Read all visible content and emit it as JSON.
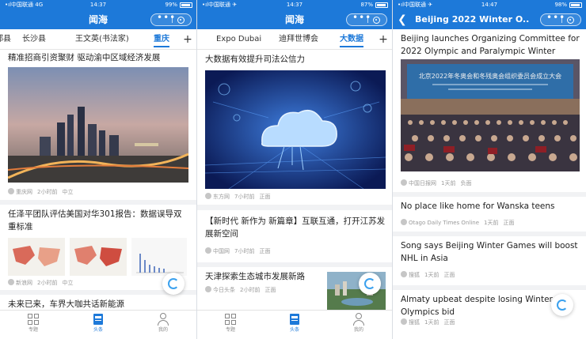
{
  "colors": {
    "brand": "#1d79d9",
    "accent": "#3ba1ee"
  },
  "screens": [
    {
      "status": {
        "carrier": "•ıl中国联通 4G",
        "time": "14:37",
        "battery": "99%"
      },
      "title": "闻海",
      "tabs": [
        {
          "label": "都县",
          "active": false
        },
        {
          "label": "长沙县",
          "active": false
        },
        {
          "label": "王文英(书法家)",
          "active": false
        },
        {
          "label": "重庆",
          "active": true
        }
      ],
      "cards": [
        {
          "title": "精准招商引资聚财 驱动渝中区域经济发展",
          "meta": [
            "重庆网",
            "2小时前",
            "中立"
          ]
        },
        {
          "title": "任泽平团队评估美国对华301报告：数据误导双重标准",
          "meta": [
            "新浪网",
            "2小时前",
            "中立"
          ]
        },
        {
          "title": "未来已来，车界大咖共话新能源"
        }
      ],
      "nav": [
        {
          "label": "专题",
          "icon": "grid-icon",
          "active": false
        },
        {
          "label": "头条",
          "icon": "newspaper-icon",
          "active": true
        },
        {
          "label": "我的",
          "icon": "person-icon",
          "active": false
        }
      ]
    },
    {
      "status": {
        "carrier": "•ıl中国联通 ✈",
        "time": "14:37",
        "battery": "87%"
      },
      "title": "闻海",
      "tabs": [
        {
          "label": "Expo Dubai",
          "active": false
        },
        {
          "label": "迪拜世博会",
          "active": false
        },
        {
          "label": "大数据",
          "active": true
        }
      ],
      "cards": [
        {
          "title": "大数据有效提升司法公信力",
          "meta": [
            "东方网",
            "7小时前",
            "正面"
          ]
        },
        {
          "title": "【新时代 新作为 新篇章】互联互通，打开江苏发展新空间",
          "meta": [
            "中国网",
            "7小时前",
            "正面"
          ]
        },
        {
          "title": "天津探索生态城市发展新路",
          "meta": [
            "今日头条",
            "2小时前",
            "正面"
          ]
        }
      ],
      "nav": [
        {
          "label": "专题",
          "icon": "grid-icon",
          "active": false
        },
        {
          "label": "头条",
          "icon": "newspaper-icon",
          "active": true
        },
        {
          "label": "我的",
          "icon": "person-icon",
          "active": false
        }
      ]
    },
    {
      "status": {
        "carrier": "•ıl中国联通 ✈",
        "time": "14:47",
        "battery": "98%"
      },
      "title": "Beijing 2022 Winter O...",
      "cards": [
        {
          "title": "Beijing launches Organizing Committee for 2022 Olympic and Paralympic Winter Game...",
          "meta": [
            "中国日报网",
            "1天前",
            "负面"
          ]
        },
        {
          "title": "No place like home for Wanska teens",
          "meta": [
            "Otago Daily Times Online",
            "1天前",
            "正面"
          ]
        },
        {
          "title": "Song says Beijing Winter Games will boost NHL in Asia",
          "meta": [
            "搜狐",
            "1天前",
            "正面"
          ]
        },
        {
          "title": "Almaty upbeat despite losing Winter Olympics bid",
          "meta": [
            "搜狐",
            "1天前",
            "正面"
          ]
        }
      ],
      "banner_text": "北京2022年冬奥会和冬残奥会组织委员会成立大会"
    }
  ]
}
